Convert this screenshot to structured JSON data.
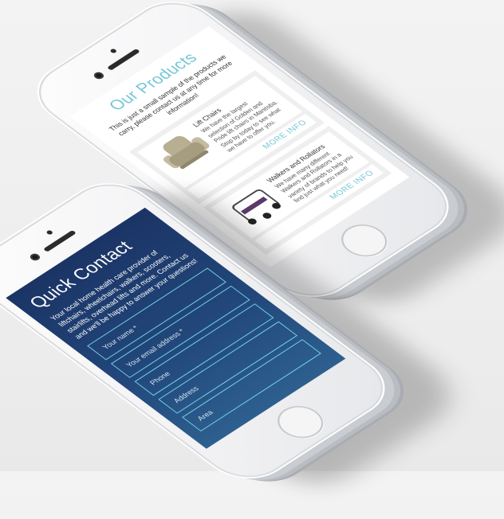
{
  "products_screen": {
    "title": "Our Products",
    "intro": "This is just a small sample of the products we carry, please contact us at any time for more information!",
    "products": [
      {
        "name": "Lift Chairs",
        "description": "We have the largest selection of Golden and Pride lift chairs in Manitoba. Stop by today to see what we have to offer you.",
        "button_label": "MORE INFO",
        "image_icon": "lift-chair-icon"
      },
      {
        "name": "Walkers and Rollators",
        "description": "We have many different Walkers and Rollators in a variety of brands to help you find just what you need!",
        "button_label": "MORE INFO",
        "image_icon": "walker-icon"
      }
    ]
  },
  "contact_screen": {
    "title": "Quick Contact",
    "intro": "Your local home health care provider of liftchairs, wheelchairs, walkers, scooters, stairlifts, overhead lifts and more. Contact us and we'll be happy to answer your questions!",
    "fields": [
      {
        "placeholder": "Your name *"
      },
      {
        "placeholder": "Your email address *"
      },
      {
        "placeholder": "Phone"
      },
      {
        "placeholder": "Address"
      },
      {
        "placeholder": "Area"
      }
    ]
  },
  "colors": {
    "accent": "#74c7d6",
    "contact_gradient_top": "#1b3466",
    "contact_gradient_bottom": "#2d5f8f",
    "field_border": "#6fd3e6"
  }
}
